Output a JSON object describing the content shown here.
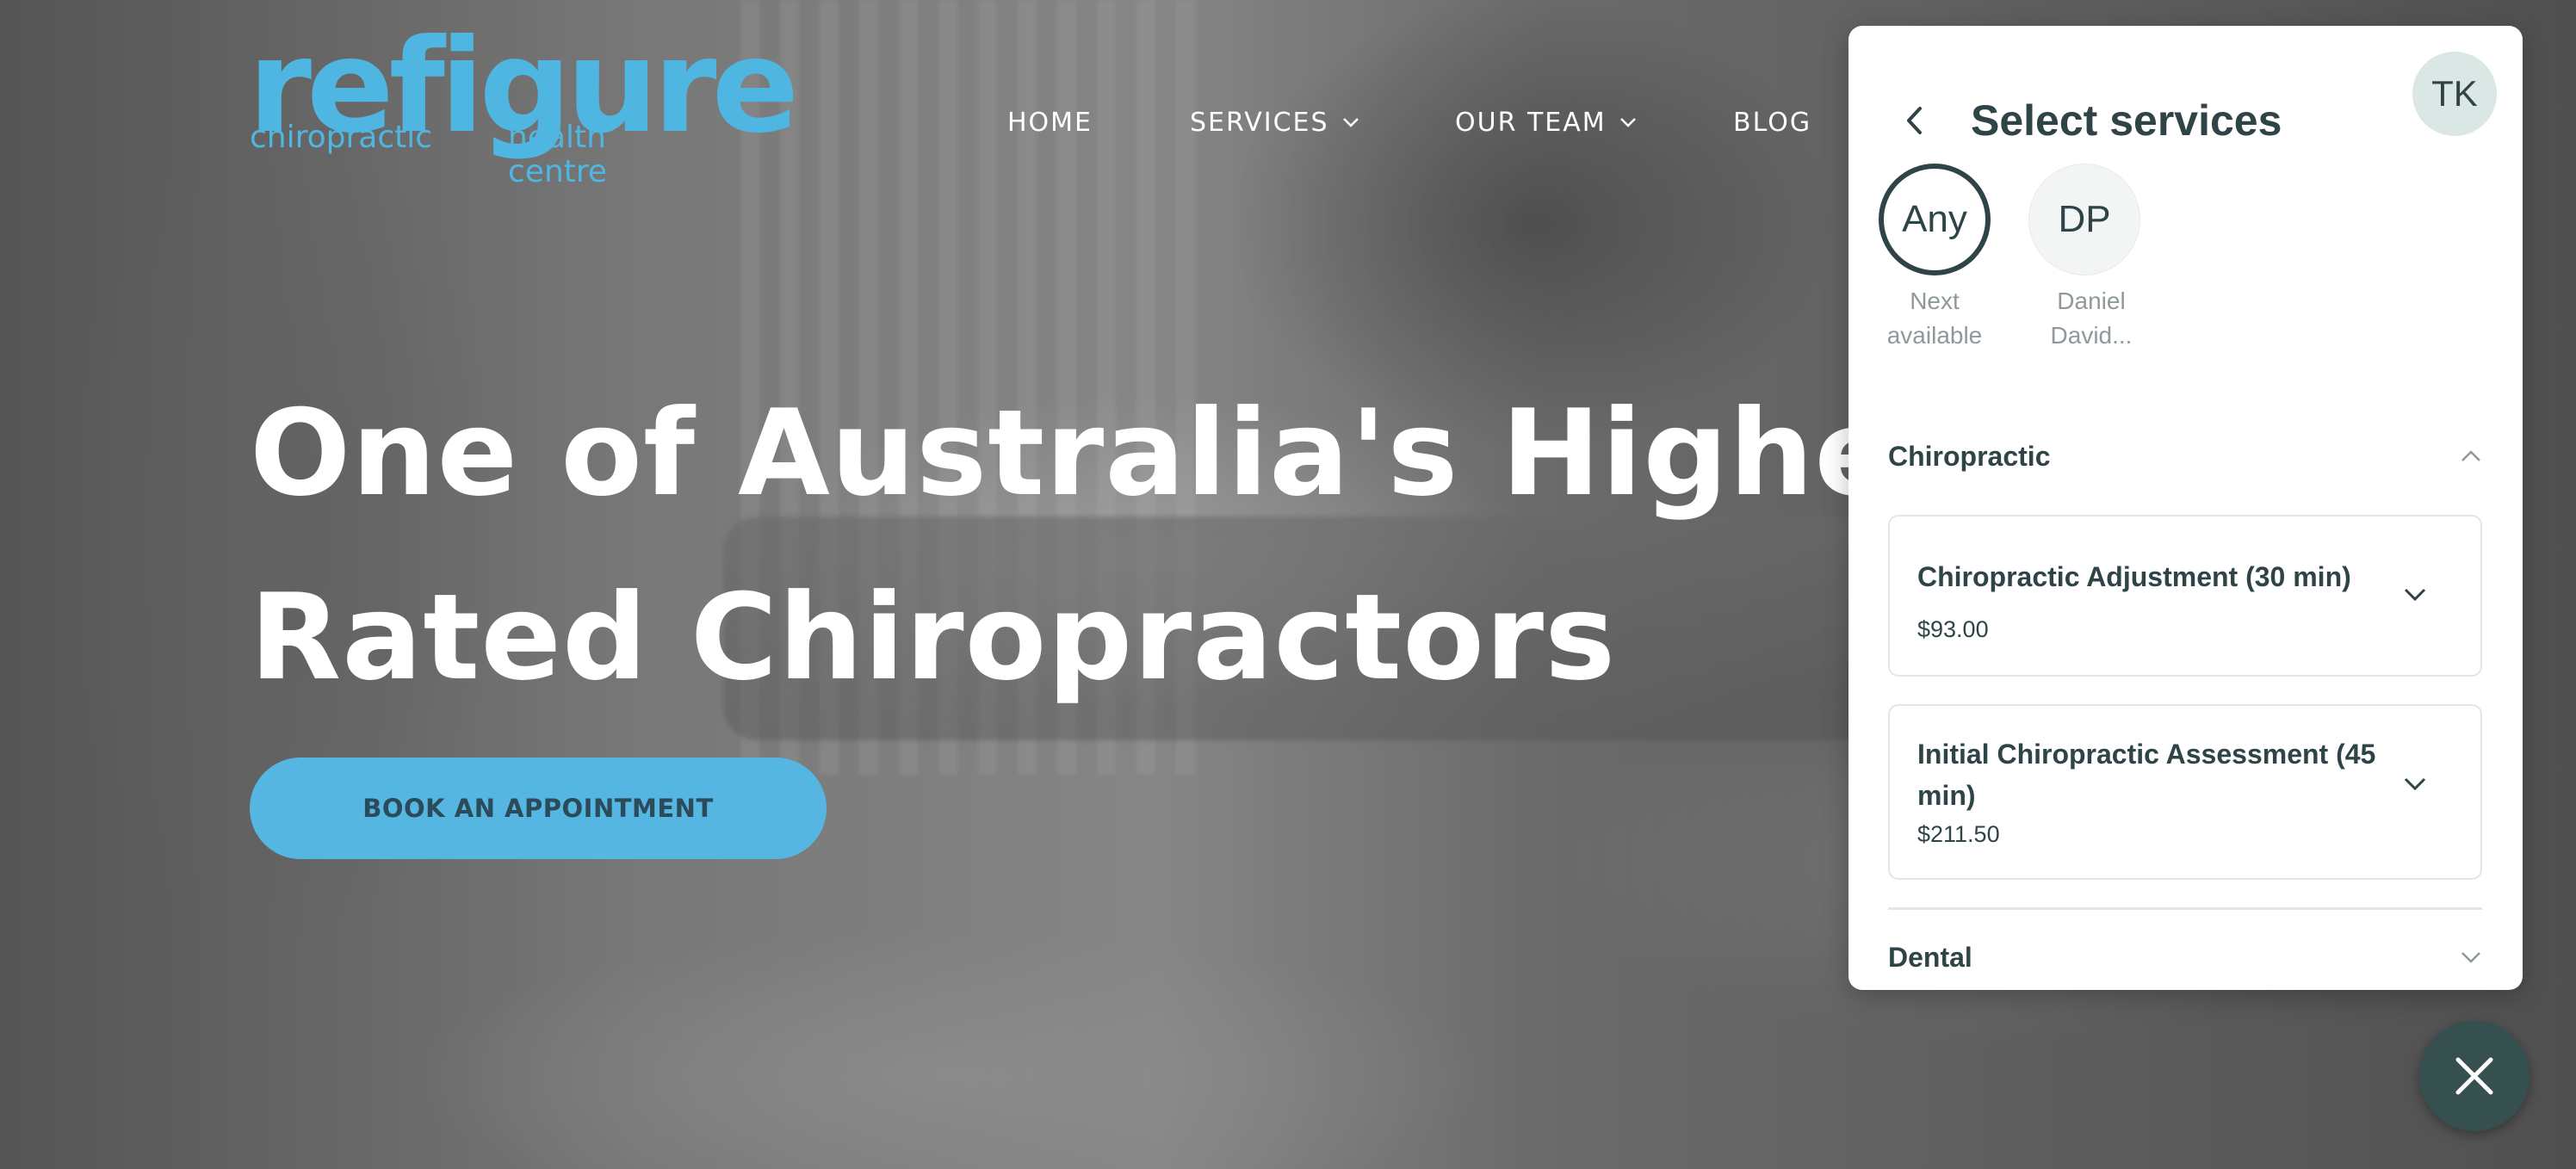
{
  "site": {
    "logo": {
      "word": "refigure",
      "sub_left": "chiropractic",
      "sub_right": "health centre"
    },
    "nav": {
      "home": "HOME",
      "services": "SERVICES",
      "our_team": "OUR TEAM",
      "blog": "BLOG"
    },
    "hero": {
      "title_line1": "One of Australia's Highest",
      "title_line2": "Rated Chiropractors",
      "cta": "BOOK AN APPOINTMENT"
    }
  },
  "booking_panel": {
    "title": "Select services",
    "user_initials": "TK",
    "staff": [
      {
        "initials": "Any",
        "label_line1": "Next",
        "label_line2": "available",
        "selected": true
      },
      {
        "initials": "DP",
        "label_line1": "Daniel",
        "label_line2": "David...",
        "selected": false
      }
    ],
    "categories": {
      "chiropractic": {
        "name": "Chiropractic",
        "expanded": true,
        "services": [
          {
            "name": "Chiropractic Adjustment (30 min)",
            "price": "$93.00"
          },
          {
            "name": "Initial Chiropractic Assessment (45 min)",
            "price": "$211.50"
          }
        ]
      },
      "dental": {
        "name": "Dental",
        "expanded": false
      }
    }
  },
  "colors": {
    "brand_blue": "#4fb6e2",
    "panel_text": "#2f4446",
    "fab": "#35504f"
  },
  "icons": {
    "back": "chevron-left-icon",
    "expand": "chevron-down-icon",
    "collapse": "chevron-up-icon",
    "close": "close-icon"
  }
}
